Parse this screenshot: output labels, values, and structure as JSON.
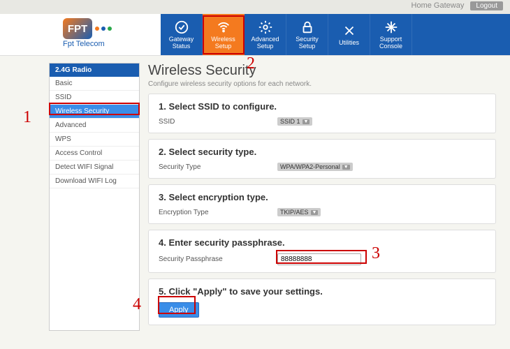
{
  "topbar": {
    "home": "Home Gateway",
    "logout": "Logout"
  },
  "brand": {
    "logo_text": "FPT",
    "sub": "Fpt Telecom"
  },
  "nav": {
    "items": [
      {
        "label": "Gateway\nStatus",
        "icon": "check-circle-icon"
      },
      {
        "label": "Wireless\nSetup",
        "icon": "wifi-icon",
        "active": true
      },
      {
        "label": "Advanced\nSetup",
        "icon": "gear-icon"
      },
      {
        "label": "Security\nSetup",
        "icon": "lock-icon"
      },
      {
        "label": "Utilities",
        "icon": "tools-icon"
      },
      {
        "label": "Support\nConsole",
        "icon": "arrows-icon"
      }
    ]
  },
  "sidebar": {
    "header": "2.4G Radio",
    "items": [
      {
        "label": "Basic"
      },
      {
        "label": "SSID"
      },
      {
        "label": "Wireless Security",
        "active": true
      },
      {
        "label": "Advanced"
      },
      {
        "label": "WPS"
      },
      {
        "label": "Access Control"
      },
      {
        "label": "Detect WIFI Signal"
      },
      {
        "label": "Download WIFI Log"
      }
    ]
  },
  "page": {
    "title": "Wireless Security",
    "subtitle": "Configure wireless security options for each network."
  },
  "steps": {
    "s1": {
      "title": "1. Select SSID to configure.",
      "label": "SSID",
      "value": "SSID 1"
    },
    "s2": {
      "title": "2. Select security type.",
      "label": "Security Type",
      "value": "WPA/WPA2-Personal"
    },
    "s3": {
      "title": "3. Select encryption type.",
      "label": "Encryption Type",
      "value": "TKIP/AES"
    },
    "s4": {
      "title": "4. Enter security passphrase.",
      "label": "Security Passphrase",
      "value": "88888888"
    },
    "s5": {
      "title": "5. Click \"Apply\" to save your settings.",
      "button": "Apply"
    }
  },
  "annotations": {
    "n1": "1",
    "n2": "2",
    "n3": "3",
    "n4": "4"
  }
}
